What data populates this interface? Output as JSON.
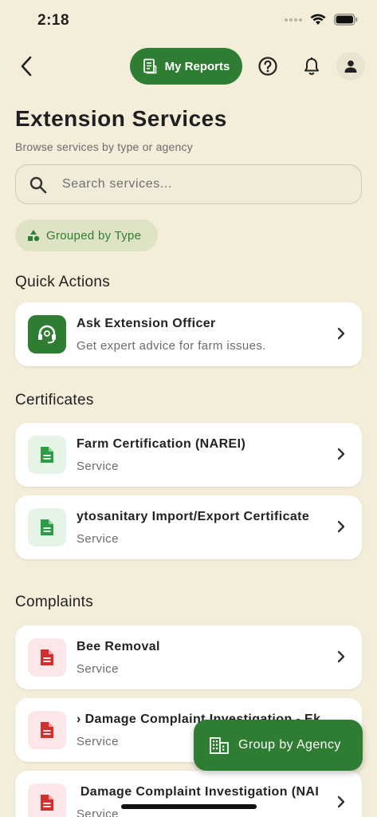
{
  "status_bar": {
    "time": "2:18"
  },
  "header": {
    "reports_label": "My Reports"
  },
  "page": {
    "title": "Extension Services",
    "subtitle": "Browse services by type or agency"
  },
  "search": {
    "placeholder": "Search services..."
  },
  "grouping_chip": {
    "label": "Grouped by Type"
  },
  "sections": {
    "quick_actions": {
      "title": "Quick Actions",
      "items": [
        {
          "title": "Ask Extension Officer",
          "subtitle": "Get expert advice for farm issues.",
          "icon": "headset-icon"
        }
      ]
    },
    "certificates": {
      "title": "Certificates",
      "items": [
        {
          "title": "Farm Certification (NAREI)",
          "subtitle": "Service",
          "icon": "document-icon"
        },
        {
          "title": "ytosanitary Import/Export Certificate",
          "subtitle": "Service",
          "icon": "document-icon"
        }
      ]
    },
    "complaints": {
      "title": "Complaints",
      "items": [
        {
          "title": "Bee Removal",
          "subtitle": "Service",
          "icon": "document-icon"
        },
        {
          "title": "› Damage Complaint Investigation - Ek",
          "subtitle": "Service",
          "icon": "document-icon"
        },
        {
          "title": " Damage Complaint Investigation (NAI",
          "subtitle": "Service",
          "icon": "document-icon"
        }
      ]
    }
  },
  "fab": {
    "label": "Group by Agency",
    "icon": "building-icon"
  },
  "colors": {
    "background": "#f3edda",
    "primary_green": "#2e7d32",
    "certificate_icon": "#2e9b46",
    "complaint_icon": "#d32f2f"
  }
}
